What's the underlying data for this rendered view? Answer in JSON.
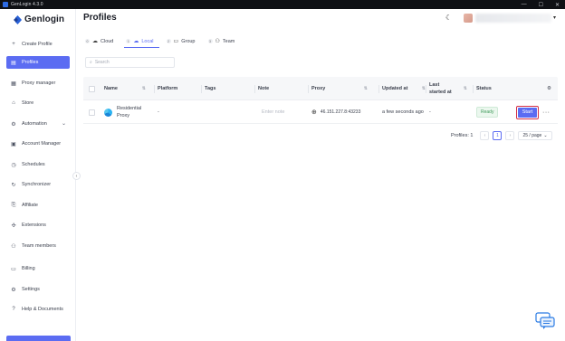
{
  "window": {
    "title": "GenLogin 4.3.0",
    "controls": [
      "—",
      "☐",
      "✕"
    ]
  },
  "brand": {
    "name": "Genlogin"
  },
  "sidebar": {
    "items": [
      {
        "label": "Create Profile",
        "icon": "plus-icon"
      },
      {
        "label": "Profiles",
        "icon": "profiles-icon",
        "active": true
      },
      {
        "label": "Proxy manager",
        "icon": "proxy-icon"
      },
      {
        "label": "Store",
        "icon": "store-icon"
      },
      {
        "label": "Automation",
        "icon": "automation-icon",
        "expandable": true
      },
      {
        "label": "Account Manager",
        "icon": "account-icon"
      },
      {
        "label": "Schedules",
        "icon": "clock-icon"
      },
      {
        "label": "Synchronizer",
        "icon": "sync-icon"
      },
      {
        "label": "Affiliate",
        "icon": "affiliate-icon"
      },
      {
        "label": "Extensions",
        "icon": "extension-icon"
      },
      {
        "label": "Team members",
        "icon": "team-icon"
      },
      {
        "label": "Billing",
        "icon": "billing-icon"
      },
      {
        "label": "Settings",
        "icon": "gear-icon"
      },
      {
        "label": "Help & Documents",
        "icon": "help-icon"
      }
    ]
  },
  "header": {
    "title": "Profiles",
    "theme_icon": "moon-icon"
  },
  "tabs": [
    {
      "key": "0",
      "label": "Cloud",
      "icon": "cloud-icon"
    },
    {
      "key": "1",
      "label": "Local",
      "icon": "cloud-off-icon",
      "active": true
    },
    {
      "key": "2",
      "label": "Group",
      "icon": "folder-icon"
    },
    {
      "key": "3",
      "label": "Team",
      "icon": "users-icon"
    }
  ],
  "search": {
    "placeholder": "Search"
  },
  "table": {
    "columns": [
      "Name",
      "Platform",
      "Tags",
      "Note",
      "Proxy",
      "Updated at",
      "Last started at",
      "Status"
    ],
    "rows": [
      {
        "name": "Residential Proxy",
        "platform": "-",
        "tags": "",
        "note_placeholder": "Enter note",
        "proxy": "46.151.227.8:43233",
        "updated_at": "a few seconds ago",
        "last_started": "-",
        "status": "Ready",
        "action": "Start"
      }
    ]
  },
  "pagination": {
    "total_label": "Profiles: 1",
    "current_page": "1",
    "page_size": "25 / page"
  },
  "colors": {
    "accent": "#5b6cf2",
    "ready": "#3f9a5a",
    "highlight": "#d32f45"
  }
}
